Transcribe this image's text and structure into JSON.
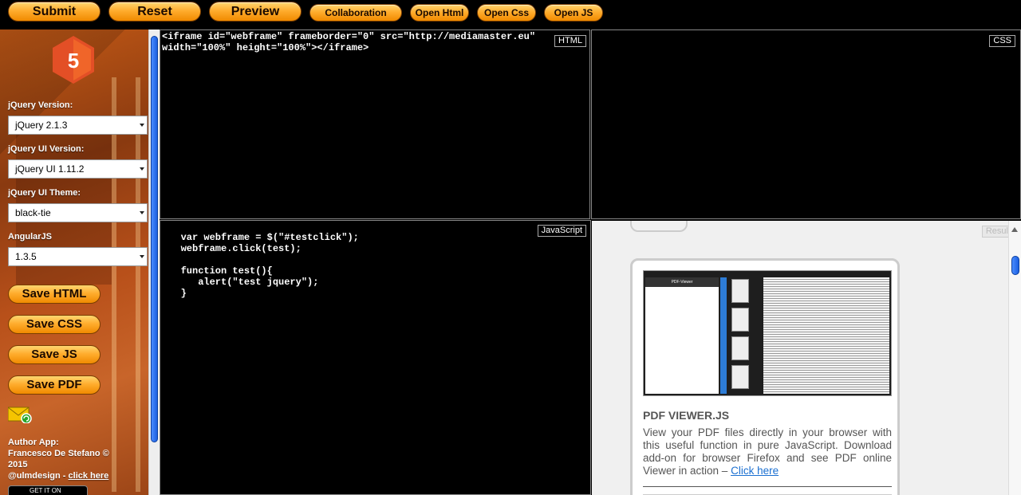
{
  "toolbar": {
    "submit": "Submit",
    "reset": "Reset",
    "preview": "Preview",
    "collaboration": "Collaboration",
    "open_html": "Open Html",
    "open_css": "Open Css",
    "open_js": "Open JS"
  },
  "sidebar": {
    "logo_text": "5",
    "jquery_label": "jQuery Version:",
    "jquery_value": "jQuery 2.1.3",
    "jqueryui_label": "jQuery UI Version:",
    "jqueryui_value": "jQuery UI 1.11.2",
    "theme_label": "jQuery UI Theme:",
    "theme_value": "black-tie",
    "angular_label": "AngularJS",
    "angular_value": "1.3.5",
    "save_html": "Save HTML",
    "save_css": "Save CSS",
    "save_js": "Save JS",
    "save_pdf": "Save PDF",
    "author_line1": "Author App:",
    "author_line2": "Francesco De Stefano ©",
    "author_line3": "2015",
    "author_handle": "@ulmdesign - ",
    "author_link": "click here",
    "get_it_on": "GET IT ON"
  },
  "panels": {
    "html_tag": "HTML",
    "css_tag": "CSS",
    "js_tag": "JavaScript",
    "result_tag": "Result",
    "html_code": "<iframe id=\"webframe\" frameborder=\"0\" src=\"http://mediamaster.eu\"\nwidth=\"100%\" height=\"100%\"></iframe>",
    "js_code": "   var webframe = $(\"#testclick\");\n   webframe.click(test);\n\n   function test(){\n      alert(\"test jquery\");\n   }"
  },
  "result": {
    "shot_header": "PDF-Viewer",
    "title": "PDF VIEWER.JS",
    "description": "View your PDF files directly in your browser with this useful function in pure JavaScript. Download add-on for browser Firefox and see PDF online Viewer in action – ",
    "link": "Click here"
  },
  "colors": {
    "accent_orange": "#ffad2e",
    "scroll_blue": "#1b5fe0",
    "link_blue": "#1a6fd1"
  }
}
